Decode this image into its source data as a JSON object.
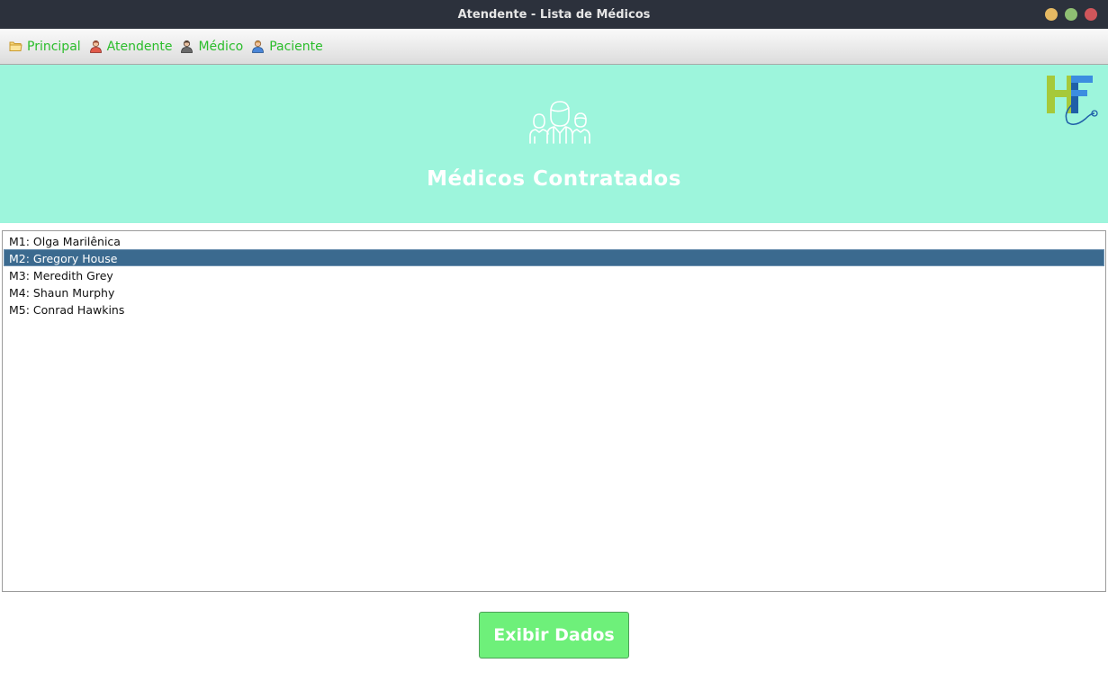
{
  "window": {
    "title": "Atendente - Lista de Médicos",
    "controls": [
      {
        "name": "minimize",
        "color": "#e5b963"
      },
      {
        "name": "maximize",
        "color": "#8fbf73"
      },
      {
        "name": "close",
        "color": "#d0565b"
      }
    ]
  },
  "menu": {
    "items": [
      {
        "label": "Principal",
        "icon": "folder-icon"
      },
      {
        "label": "Atendente",
        "icon": "attendant-user-icon"
      },
      {
        "label": "Médico",
        "icon": "doctor-user-icon"
      },
      {
        "label": "Paciente",
        "icon": "patient-user-icon"
      }
    ],
    "color": "#2bbd2b"
  },
  "banner": {
    "title": "Médicos Contratados",
    "icon": "medical-team-icon",
    "logo": "hf-logo",
    "background": "#9df5dc"
  },
  "doctors": {
    "items": [
      {
        "label": "M1: Olga Marilênica",
        "selected": false
      },
      {
        "label": "M2: Gregory House",
        "selected": true
      },
      {
        "label": "M3: Meredith Grey",
        "selected": false
      },
      {
        "label": "M4: Shaun Murphy",
        "selected": false
      },
      {
        "label": "M5: Conrad Hawkins",
        "selected": false
      }
    ],
    "selected_color": "#3b6a8f"
  },
  "actions": {
    "show_data_label": "Exibir Dados",
    "button_color": "#6ef07a"
  }
}
